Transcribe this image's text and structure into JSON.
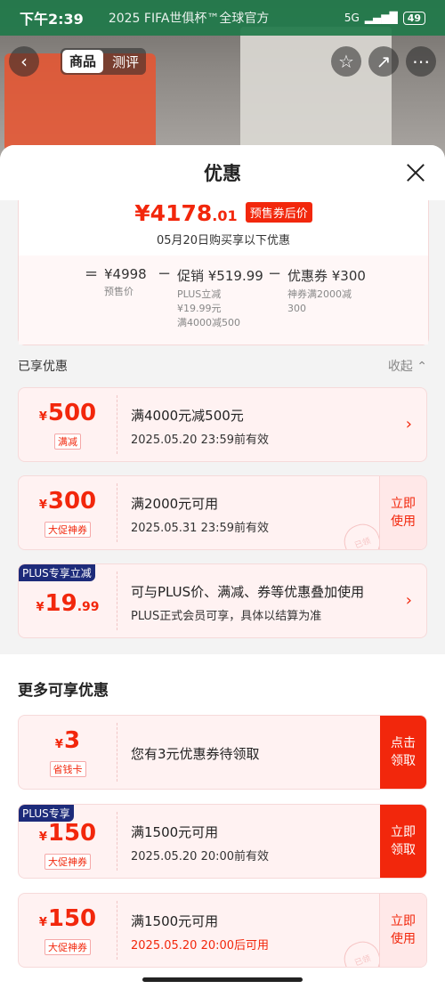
{
  "status_bar": {
    "time": "下午2:39",
    "banner_text": "2025 FIFA世俱杯™全球官方",
    "network": "5G",
    "battery": "49"
  },
  "nav": {
    "tabs": [
      "商品",
      "测评"
    ]
  },
  "sheet": {
    "title": "优惠"
  },
  "price_card": {
    "final_price_main": "¥4178",
    "final_price_decimal": ".01",
    "final_tag": "预售券后价",
    "date_note": "05月20日购买享以下优惠",
    "presale_price": "¥4998",
    "presale_label": "预售价",
    "promo_price": "促销 ¥519.99",
    "promo_sub1": "PLUS立减",
    "promo_sub2": "¥19.99元",
    "promo_sub3": "满4000减500",
    "coupon_price": "优惠券 ¥300",
    "coupon_sub1": "神券满2000减",
    "coupon_sub2": "300"
  },
  "enjoyed": {
    "label": "已享优惠",
    "collapse_label": "收起",
    "coupons": [
      {
        "currency": "¥",
        "amount": "500",
        "decimal": "",
        "tag": "满减",
        "title": "满4000元减500元",
        "subtitle": "2025.05.20 23:59前有效"
      },
      {
        "currency": "¥",
        "amount": "300",
        "decimal": "",
        "tag": "大促神券",
        "title": "满2000元可用",
        "subtitle": "2025.05.31 23:59前有效",
        "action": "立即使用",
        "stamp": "已领"
      },
      {
        "badge": "PLUS专享立减",
        "currency": "¥",
        "amount": "19",
        "decimal": ".99",
        "title": "可与PLUS价、满减、券等优惠叠加使用",
        "subtitle": "PLUS正式会员可享，具体以结算为准"
      }
    ]
  },
  "more": {
    "title": "更多可享优惠",
    "coupons": [
      {
        "currency": "¥",
        "amount": "3",
        "tag": "省钱卡",
        "title": "您有3元优惠券待领取",
        "action": "点击领取"
      },
      {
        "badge": "PLUS专享",
        "currency": "¥",
        "amount": "150",
        "tag": "大促神券",
        "title": "满1500元可用",
        "subtitle": "2025.05.20 20:00前有效",
        "action": "立即领取"
      },
      {
        "currency": "¥",
        "amount": "150",
        "tag": "大促神券",
        "title": "满1500元可用",
        "subtitle": "2025.05.20 20:00后可用",
        "action": "立即使用",
        "stamp": "已领"
      }
    ]
  },
  "colors": {
    "accent": "#f2270c",
    "plus_badge": "#1d2b7a"
  }
}
